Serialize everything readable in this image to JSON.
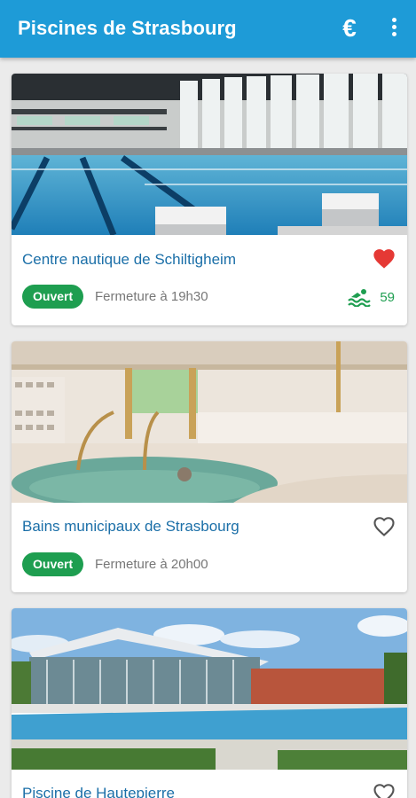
{
  "app": {
    "title": "Piscines de Strasbourg",
    "currency_icon": "euro-icon",
    "menu_icon": "more-vert-icon"
  },
  "colors": {
    "primary": "#1e9bd7",
    "open_badge": "#1e9e50",
    "favorite": "#e53935",
    "name_text": "#1b6fa8"
  },
  "pools": [
    {
      "name": "Centre nautique de Schiltigheim",
      "status": "Ouvert",
      "closing": "Fermeture à 19h30",
      "favorite": true,
      "occupancy": "59",
      "occupancy_icon": "swimmer-icon"
    },
    {
      "name": "Bains municipaux de Strasbourg",
      "status": "Ouvert",
      "closing": "Fermeture à 20h00",
      "favorite": false
    },
    {
      "name": "Piscine de Hautepierre",
      "favorite": false
    }
  ]
}
